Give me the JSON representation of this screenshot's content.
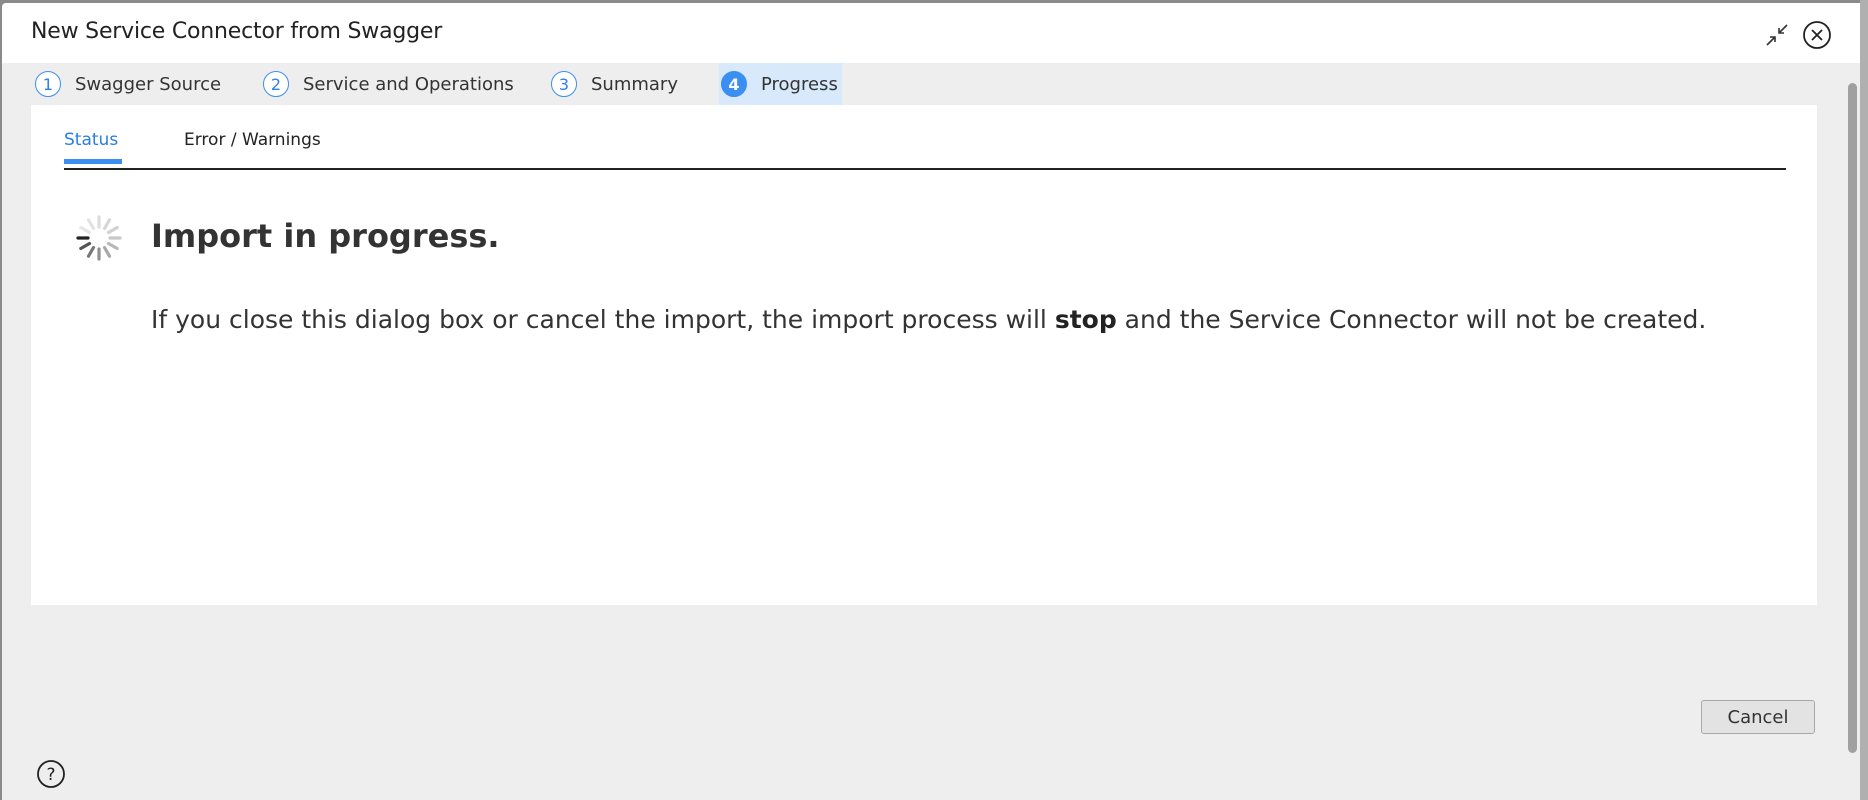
{
  "dialog": {
    "title": "New Service Connector from Swagger",
    "collapse_icon": "collapse-arrows-icon",
    "close_icon": "close-circle-icon"
  },
  "steps": [
    {
      "number": "1",
      "label": "Swagger Source",
      "active": false
    },
    {
      "number": "2",
      "label": "Service and Operations",
      "active": false
    },
    {
      "number": "3",
      "label": "Summary",
      "active": false
    },
    {
      "number": "4",
      "label": "Progress",
      "active": true
    }
  ],
  "tabs": [
    {
      "label": "Status",
      "active": true
    },
    {
      "label": "Error / Warnings",
      "active": false
    }
  ],
  "status": {
    "icon": "loading-spinner-icon",
    "title": "Import in progress.",
    "message_before": "If you close this dialog box or cancel the import, the import process will ",
    "message_bold": "stop",
    "message_after": " and the Service Connector will not be created."
  },
  "footer": {
    "cancel_label": "Cancel",
    "help_icon": "help-icon"
  },
  "colors": {
    "accent": "#3a8ff0",
    "active_step_bg": "#d7e9fa",
    "active_tab_text": "#2a7de1"
  }
}
